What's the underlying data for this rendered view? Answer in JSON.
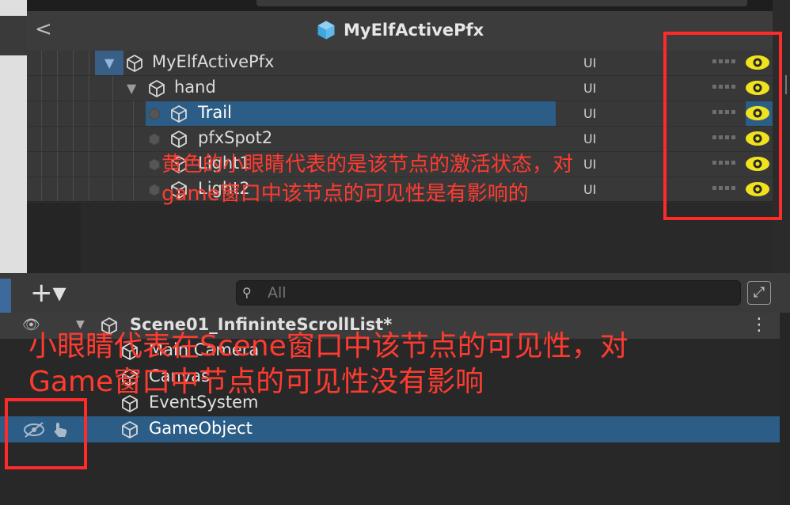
{
  "prefab": {
    "title": "MyElfActivePfx",
    "back_label": "<",
    "items": [
      {
        "name": "MyElfActivePfx",
        "layer": "UI"
      },
      {
        "name": "hand",
        "layer": "UI"
      },
      {
        "name": "Trail",
        "layer": "UI"
      },
      {
        "name": "pfxSpot2",
        "layer": "UI"
      },
      {
        "name": "Light1",
        "layer": "UI"
      },
      {
        "name": "Light2",
        "layer": "UI"
      }
    ]
  },
  "annotations": {
    "top_note_line1": "黄色的小眼睛代表的是该节点的激活状态，对",
    "top_note_line2": "game窗口中该节点的可见性是有影响的",
    "bottom_note_line1": "小眼睛代表在Scene窗口中该节点的可见性，对",
    "bottom_note_line2": "Game窗口中节点的可见性没有影响"
  },
  "hierarchy": {
    "add_label": "+▾",
    "search_placeholder": "All",
    "scene_name": "Scene01_InfininteScrollList*",
    "menu_label": "⋮",
    "items": [
      {
        "name": "Main Camera"
      },
      {
        "name": "Canvas"
      },
      {
        "name": "EventSystem"
      },
      {
        "name": "GameObject"
      }
    ]
  },
  "colors": {
    "eye_active": "#f0e21e",
    "selection": "#2c5d87",
    "annotation": "#ff2a2a"
  },
  "icons": [
    "back-chevron-icon",
    "prefab-cube-icon",
    "gameobject-cube-icon",
    "visibility-eye-icon",
    "hidden-eye-icon",
    "pick-hand-icon",
    "search-icon",
    "lock-icon",
    "foldout-arrow-icon",
    "scene-icon",
    "kebab-menu-icon"
  ]
}
